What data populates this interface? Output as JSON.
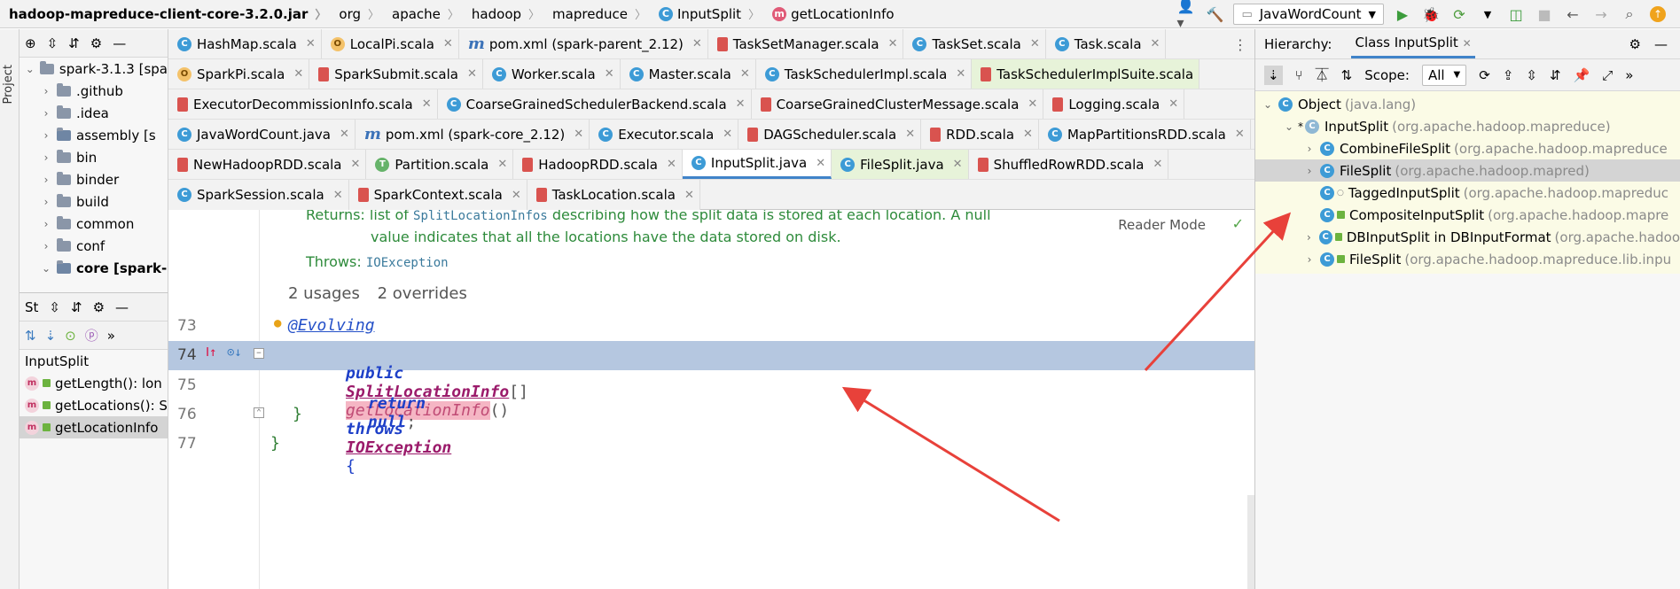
{
  "navbar": {
    "breadcrumbs": [
      "hadoop-mapreduce-client-core-3.2.0.jar",
      "org",
      "apache",
      "hadoop",
      "mapreduce",
      "InputSplit",
      "getLocationInfo"
    ],
    "run_config": "JavaWordCount"
  },
  "left_stripe": {
    "label": "Project"
  },
  "project": {
    "items": [
      {
        "label": "spark-3.1.3 [spa"
      },
      {
        "label": ".github"
      },
      {
        "label": ".idea"
      },
      {
        "label": "assembly [s"
      },
      {
        "label": "bin"
      },
      {
        "label": "binder"
      },
      {
        "label": "build"
      },
      {
        "label": "common"
      },
      {
        "label": "conf"
      },
      {
        "label": "core [spark-"
      }
    ]
  },
  "structure": {
    "title": "St",
    "items": [
      {
        "label": "InputSplit"
      },
      {
        "label": "getLength(): lon"
      },
      {
        "label": "getLocations(): S"
      },
      {
        "label": "getLocationInfo"
      }
    ]
  },
  "tabs": {
    "rows": [
      [
        {
          "label": "HashMap.scala",
          "icon": "class"
        },
        {
          "label": "LocalPi.scala",
          "icon": "object"
        },
        {
          "label": "pom.xml (spark-parent_2.12)",
          "icon": "maven"
        },
        {
          "label": "TaskSetManager.scala",
          "icon": "scala"
        },
        {
          "label": "TaskSet.scala",
          "icon": "class"
        },
        {
          "label": "Task.scala",
          "icon": "class"
        }
      ],
      [
        {
          "label": "SparkPi.scala",
          "icon": "object"
        },
        {
          "label": "SparkSubmit.scala",
          "icon": "scala"
        },
        {
          "label": "Worker.scala",
          "icon": "class"
        },
        {
          "label": "Master.scala",
          "icon": "class"
        },
        {
          "label": "TaskSchedulerImpl.scala",
          "icon": "class"
        },
        {
          "label": "TaskSchedulerImplSuite.scala",
          "icon": "scala"
        }
      ],
      [
        {
          "label": "ExecutorDecommissionInfo.scala",
          "icon": "scala"
        },
        {
          "label": "CoarseGrainedSchedulerBackend.scala",
          "icon": "class"
        },
        {
          "label": "CoarseGrainedClusterMessage.scala",
          "icon": "scala"
        },
        {
          "label": "Logging.scala",
          "icon": "scala"
        }
      ],
      [
        {
          "label": "JavaWordCount.java",
          "icon": "class"
        },
        {
          "label": "pom.xml (spark-core_2.12)",
          "icon": "maven"
        },
        {
          "label": "Executor.scala",
          "icon": "class"
        },
        {
          "label": "DAGScheduler.scala",
          "icon": "scala"
        },
        {
          "label": "RDD.scala",
          "icon": "scala"
        },
        {
          "label": "MapPartitionsRDD.scala",
          "icon": "class"
        }
      ],
      [
        {
          "label": "NewHadoopRDD.scala",
          "icon": "scala"
        },
        {
          "label": "Partition.scala",
          "icon": "trait"
        },
        {
          "label": "HadoopRDD.scala",
          "icon": "scala"
        },
        {
          "label": "InputSplit.java",
          "icon": "class"
        },
        {
          "label": "FileSplit.java",
          "icon": "class"
        },
        {
          "label": "ShuffledRowRDD.scala",
          "icon": "scala"
        }
      ],
      [
        {
          "label": "SparkSession.scala",
          "icon": "class"
        },
        {
          "label": "SparkContext.scala",
          "icon": "scala"
        },
        {
          "label": "TaskLocation.scala",
          "icon": "scala"
        }
      ]
    ]
  },
  "editor": {
    "doc_returns_label": "Returns:",
    "doc_returns_text_a": "list of ",
    "doc_returns_mono": "SplitLocationInfos",
    "doc_returns_text_b": " describing how the split data is stored at each location. A null",
    "doc_returns_text_c": "value indicates that all the locations have the data stored on disk.",
    "doc_throws_label": "Throws:",
    "doc_throws_value": "IOException",
    "reader_mode": "Reader Mode",
    "usages": "2 usages",
    "overrides": "2 overrides",
    "lines": [
      {
        "num": "73"
      },
      {
        "num": "74"
      },
      {
        "num": "75"
      },
      {
        "num": "76"
      },
      {
        "num": "77"
      }
    ],
    "code": {
      "annotation": "@Evolving",
      "kw_public": "public",
      "return_type": "SplitLocationInfo",
      "brackets": "[]",
      "method": "getLocationInfo",
      "parens": "()",
      "kw_throws": "throws",
      "exception": "IOException",
      "open_brace": "{",
      "kw_return": "return",
      "kw_null": "null",
      "semicolon": ";",
      "close_brace": "}",
      "class_close": "}"
    }
  },
  "hierarchy": {
    "label": "Hierarchy:",
    "tab": "Class InputSplit",
    "scope_label": "Scope:",
    "scope_value": "All",
    "items": [
      {
        "name": "Object",
        "pkg": "(java.lang)"
      },
      {
        "name": "InputSplit",
        "pkg": "(org.apache.hadoop.mapreduce)"
      },
      {
        "name": "CombineFileSplit",
        "pkg": "(org.apache.hadoop.mapreduce"
      },
      {
        "name": "FileSplit",
        "pkg": "(org.apache.hadoop.mapred)"
      },
      {
        "name": "TaggedInputSplit",
        "pkg": "(org.apache.hadoop.mapreduc"
      },
      {
        "name": "CompositeInputSplit",
        "pkg": "(org.apache.hadoop.mapre"
      },
      {
        "name": "DBInputSplit in DBInputFormat",
        "pkg": "(org.apache.hadoo"
      },
      {
        "name": "FileSplit",
        "pkg": "(org.apache.hadoop.mapreduce.lib.inpu"
      }
    ]
  },
  "colors": {
    "highlight_line": "#b5c7e0",
    "arrow": "#e8413a",
    "hierarchy_bg": "#fbfbe6"
  }
}
